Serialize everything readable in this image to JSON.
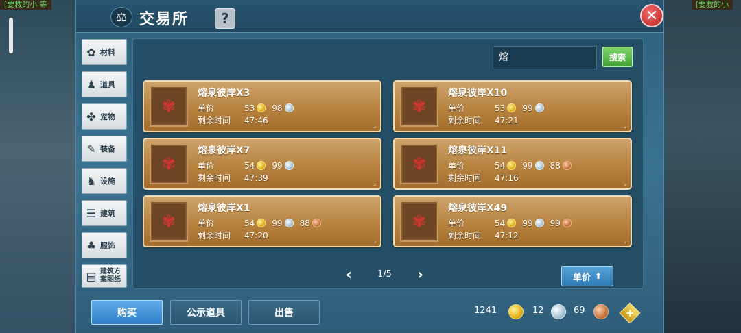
{
  "corner_left": "[要救的小 等",
  "corner_right": "[要救的小",
  "header": {
    "title": "交易所",
    "help": "?",
    "close": "✕"
  },
  "categories": [
    {
      "label": "材料",
      "icon": "material-icon"
    },
    {
      "label": "道具",
      "icon": "item-icon"
    },
    {
      "label": "宠物",
      "icon": "paw-icon"
    },
    {
      "label": "装备",
      "icon": "equipment-icon"
    },
    {
      "label": "设施",
      "icon": "facility-icon"
    },
    {
      "label": "建筑",
      "icon": "building-icon"
    },
    {
      "label": "服饰",
      "icon": "clothing-icon"
    },
    {
      "label": "建筑方案图纸",
      "icon": "blueprint-icon"
    }
  ],
  "search": {
    "value": "熔",
    "button": "搜索"
  },
  "listing_labels": {
    "price": "单价",
    "time": "剩余时间"
  },
  "listings": [
    {
      "name": "熔泉彼岸X3",
      "gold": "53",
      "silver": "98",
      "copper": "",
      "time": "47:46"
    },
    {
      "name": "熔泉彼岸X10",
      "gold": "53",
      "silver": "99",
      "copper": "",
      "time": "47:21"
    },
    {
      "name": "熔泉彼岸X7",
      "gold": "54",
      "silver": "99",
      "copper": "",
      "time": "47:39"
    },
    {
      "name": "熔泉彼岸X11",
      "gold": "54",
      "silver": "99",
      "copper": "88",
      "time": "47:16"
    },
    {
      "name": "熔泉彼岸X1",
      "gold": "54",
      "silver": "99",
      "copper": "88",
      "time": "47:20"
    },
    {
      "name": "熔泉彼岸X49",
      "gold": "54",
      "silver": "99",
      "copper": "99",
      "time": "47:12"
    }
  ],
  "pager": {
    "prev": "‹",
    "page": "1/5",
    "next": "›"
  },
  "sort": {
    "label": "单价"
  },
  "tabs": {
    "buy": "购买",
    "public": "公示道具",
    "sell": "出售"
  },
  "currency": {
    "gold": "1241",
    "silver": "12",
    "copper": "69",
    "add": "+"
  },
  "colors": {
    "gold": "#e5b318",
    "silver": "#a8c4d4",
    "copper": "#c8763e",
    "buy_tab": "#2f7fc8",
    "search_button": "#43a233"
  }
}
